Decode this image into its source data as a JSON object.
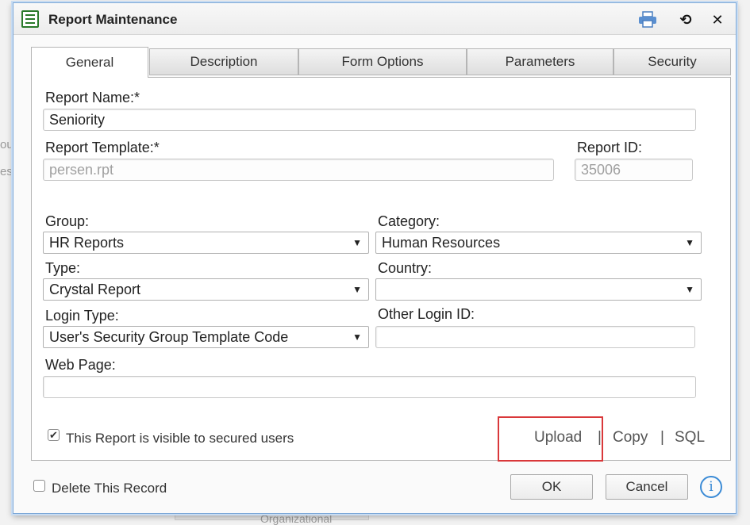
{
  "dialog": {
    "title": "Report Maintenance",
    "tabs": [
      "General",
      "Description",
      "Form Options",
      "Parameters",
      "Security"
    ]
  },
  "form": {
    "report_name_label": "Report Name:*",
    "report_name_value": "Seniority",
    "report_template_label": "Report Template:*",
    "report_template_value": "persen.rpt",
    "report_id_label": "Report ID:",
    "report_id_value": "35006",
    "group_label": "Group:",
    "group_value": "HR Reports",
    "category_label": "Category:",
    "category_value": "Human Resources",
    "type_label": "Type:",
    "type_value": "Crystal Report",
    "country_label": "Country:",
    "country_value": "",
    "login_type_label": "Login Type:",
    "login_type_value": "User's Security Group Template Code",
    "other_login_label": "Other Login ID:",
    "other_login_value": "",
    "web_page_label": "Web Page:",
    "web_page_value": "",
    "visible_checkbox_label": "This Report is visible to secured users",
    "visible_checked": true
  },
  "actions": {
    "upload": "Upload",
    "copy": "Copy",
    "sql": "SQL",
    "separator": "|"
  },
  "footer": {
    "delete_label": "Delete This Record",
    "ok": "OK",
    "cancel": "Cancel",
    "info": "i"
  },
  "background": {
    "frag1": "ou",
    "frag2": "est",
    "frag3": "Organizational"
  },
  "colors": {
    "highlight": "#d9383a",
    "accent": "#3b8bd6"
  }
}
